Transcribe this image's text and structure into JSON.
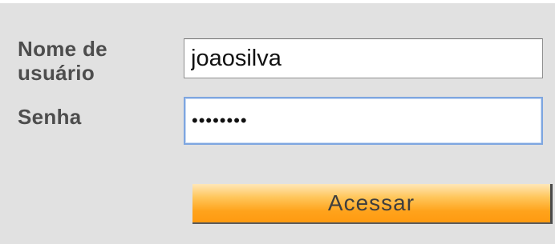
{
  "login_form": {
    "username_label": "Nome de usuário",
    "username_value": "joaosilva",
    "password_label": "Senha",
    "password_value": "xxxxxxxx",
    "submit_label": "Acessar"
  }
}
